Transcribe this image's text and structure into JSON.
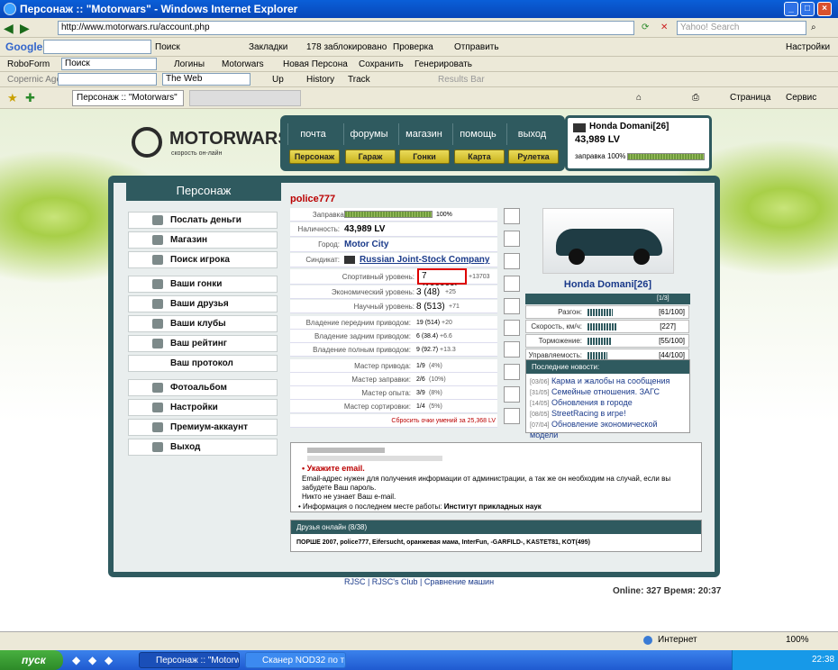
{
  "window": {
    "title": "Персонаж :: \"Motorwars\" - Windows Internet Explorer"
  },
  "address": {
    "url": "http://www.motorwars.ru/account.php",
    "search_placeholder": "Yahoo! Search"
  },
  "google_bar": {
    "brand": "Google",
    "search_btn": "Поиск",
    "bookmarks": "Закладки",
    "blocked": "178 заблокировано",
    "check": "Проверка",
    "send": "Отправить",
    "settings": "Настройки"
  },
  "roboform_bar": {
    "brand": "RoboForm",
    "search": "Поиск",
    "logins": "Логины",
    "site": "Motorwars",
    "new_persona": "Новая Персона",
    "save": "Сохранить",
    "generate": "Генерировать"
  },
  "copernic_bar": {
    "brand": "Copernic Agent",
    "web": "The Web",
    "up": "Up",
    "history": "History",
    "track": "Track",
    "results": "Results Bar"
  },
  "tabs_bar": {
    "tab": "Персонаж :: \"Motorwars\"",
    "page": "Страница",
    "service": "Сервис"
  },
  "site": {
    "logo": "MOTORWARS.RU",
    "logo_sub": "скорость он-лайн",
    "nav_top": [
      "почта",
      "форумы",
      "магазин",
      "помощь",
      "выход"
    ],
    "nav_bottom": [
      "Персонаж",
      "Гараж",
      "Гонки",
      "Карта",
      "Рулетка"
    ],
    "car_name": "Honda Domani[26]",
    "money": "43,989 LV",
    "fuel": "заправка 100%",
    "fuel_pct": 100
  },
  "left": {
    "title": "Персонаж",
    "items": [
      "Послать деньги",
      "Магазин",
      "Поиск игрока",
      "Ваши гонки",
      "Ваши друзья",
      "Ваши клубы",
      "Ваш рейтинг",
      "Ваш протокол",
      "Фотоальбом",
      "Настройки",
      "Премиум-аккаунт",
      "Выход"
    ]
  },
  "player": {
    "name": "police777",
    "rows": [
      {
        "label": "Заправка:",
        "value": "100%"
      },
      {
        "label": "Наличность:",
        "value": "43,989 LV"
      },
      {
        "label": "Город:",
        "value": "Motor City"
      },
      {
        "label": "Синдикат:",
        "value": "Russian Joint-Stock Company"
      },
      {
        "label": "Спортивный уровень:",
        "value": "7 (100009)",
        "extra": "+13703"
      },
      {
        "label": "Экономический уровень:",
        "value": "3 (48)",
        "extra": "+25"
      },
      {
        "label": "Научный уровень:",
        "value": "8 (513)",
        "extra": "+71"
      },
      {
        "label": "Владение передним приводом:",
        "value": "19 (514)",
        "extra": "+20"
      },
      {
        "label": "Владение задним приводом:",
        "value": "6 (38.4)",
        "extra": "+6.6"
      },
      {
        "label": "Владение полным приводом:",
        "value": "9 (92.7)",
        "extra": "+13.3"
      },
      {
        "label": "Мастер привода:",
        "value": "1/9",
        "extra": "(4%)"
      },
      {
        "label": "Мастер заправки:",
        "value": "2/6",
        "extra": "(10%)"
      },
      {
        "label": "Мастер опыта:",
        "value": "3/9",
        "extra": "(8%)"
      },
      {
        "label": "Мастер сортировки:",
        "value": "1/4",
        "extra": "(5%)"
      }
    ],
    "reset": "Сбросить очки умений за 25,368 LV"
  },
  "car": {
    "name": "Honda Domani[26]",
    "page": "[1/3]",
    "stats": [
      {
        "label": "Разгон:",
        "value": "[61/100]",
        "pct": 61
      },
      {
        "label": "Скорость, км/ч:",
        "value": "[227]",
        "pct": 70
      },
      {
        "label": "Торможение:",
        "value": "[55/100]",
        "pct": 55
      },
      {
        "label": "Управляемость:",
        "value": "[44/100]",
        "pct": 44
      }
    ]
  },
  "news": {
    "title": "Последние новости:",
    "items": [
      {
        "date": "[03/06]",
        "text": "Карма и жалобы на сообщения"
      },
      {
        "date": "[31/05]",
        "text": "Семейные отношения. ЗАГС"
      },
      {
        "date": "[14/05]",
        "text": "Обновления в городе"
      },
      {
        "date": "[08/05]",
        "text": "StreetRacing в игре!"
      },
      {
        "date": "[07/04]",
        "text": "Обновление экономической модели"
      }
    ]
  },
  "info": {
    "email_title": "Укажите email.",
    "email_text": "Email-адрес нужен для получения информации от администрации, а так же он необходим на случай, если вы забудете Ваш пароль.",
    "email_note": "Никто не узнает Ваш e-mail.",
    "work_label": "Информация о последнем месте работы:",
    "work_value": "Институт прикладных наук"
  },
  "friends": {
    "title": "Друзья онлайн (8/38)",
    "list": "ПОРШЕ 2007, police777, Eifersucht, оранжевая мама, InterFun, -GARFILD-, KASTET81, KOT(495)"
  },
  "footer": {
    "links": "RJSC | RJSC's Club | Сравнение машин",
    "online": "Online: 327  Время: 20:37"
  },
  "status": {
    "zone": "Интернет",
    "zoom": "100%"
  },
  "taskbar": {
    "start": "пуск",
    "task1": "Персонаж :: \"Motorw...",
    "task2": "Сканер NOD32 по тр...",
    "clock": "22:38"
  }
}
